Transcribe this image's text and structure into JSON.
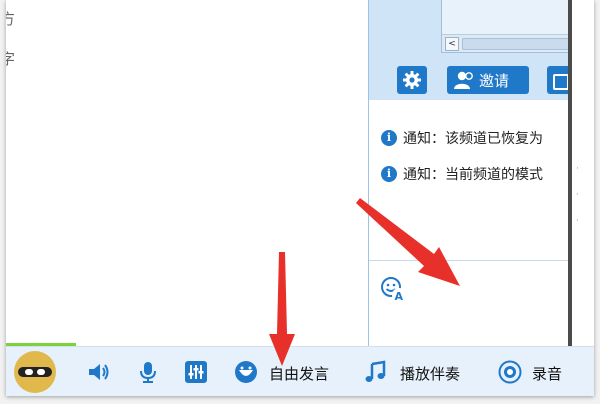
{
  "left_edge_chars": [
    "方",
    "字"
  ],
  "right_panel": {
    "scroll_left_arrow": "<",
    "invite_label": "邀请"
  },
  "notices": [
    {
      "text": "通知：该频道已恢复为"
    },
    {
      "text": "通知：当前频道的模式"
    }
  ],
  "bottom_toolbar": {
    "free_speak_label": "自由发言",
    "play_accompaniment_label": "播放伴奏",
    "record_label": "录音"
  },
  "colors": {
    "accent_blue": "#1f78c8",
    "panel_blue": "#cfe4f6",
    "toolbar_bg": "#e6f1fb",
    "arrow_red": "#e8302a"
  }
}
